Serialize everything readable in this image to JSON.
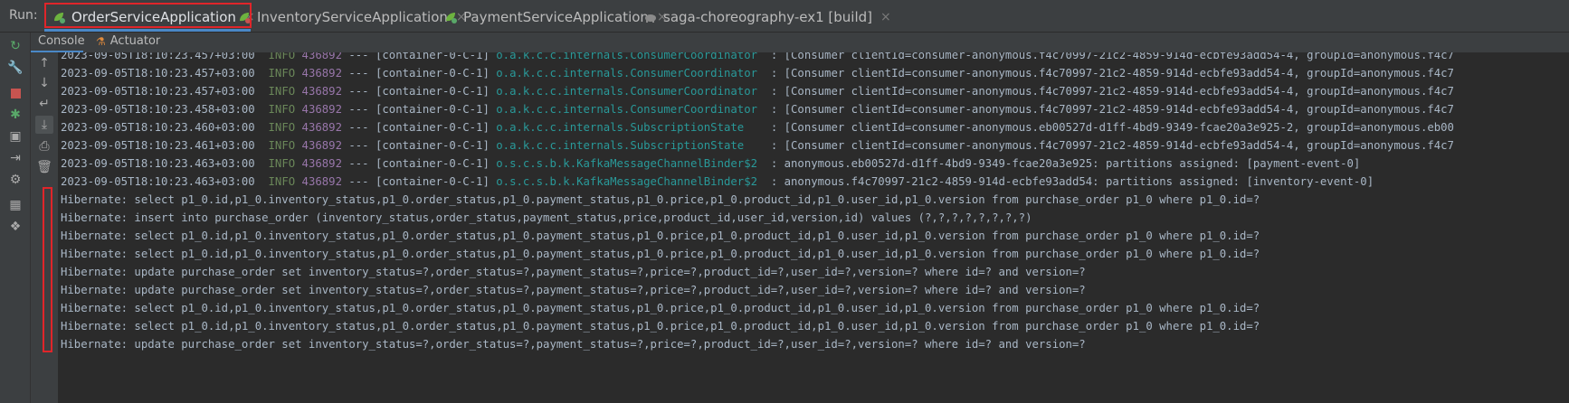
{
  "run_label": "Run:",
  "tabs": [
    {
      "label": "OrderServiceApplication",
      "active": true,
      "close": "×"
    },
    {
      "label": "InventoryServiceApplication",
      "active": false,
      "close": "×"
    },
    {
      "label": "PaymentServiceApplication",
      "active": false,
      "close": "×"
    },
    {
      "label": "saga-choreography-ex1 [build]",
      "active": false,
      "close": "×"
    }
  ],
  "subtabs": {
    "console": "Console",
    "actuator": "Actuator"
  },
  "colors": {
    "accent": "#4a88c7",
    "highlight": "#e0252a",
    "info": "#6a8759",
    "pid": "#9876aa",
    "logger": "#299999"
  },
  "log_lines": [
    {
      "ts": "2023-09-05T18:10:23.457+03:00",
      "level": "INFO",
      "pid": "436892",
      "sep": "---",
      "thread": "[container-0-C-1]",
      "logger": "o.a.k.c.c.internals.ConsumerCoordinator ",
      "msg": ": [Consumer clientId=consumer-anonymous.f4c70997-21c2-4859-914d-ecbfe93add54-4, groupId=anonymous.f4c7"
    },
    {
      "ts": "2023-09-05T18:10:23.457+03:00",
      "level": "INFO",
      "pid": "436892",
      "sep": "---",
      "thread": "[container-0-C-1]",
      "logger": "o.a.k.c.c.internals.ConsumerCoordinator ",
      "msg": ": [Consumer clientId=consumer-anonymous.f4c70997-21c2-4859-914d-ecbfe93add54-4, groupId=anonymous.f4c7"
    },
    {
      "ts": "2023-09-05T18:10:23.457+03:00",
      "level": "INFO",
      "pid": "436892",
      "sep": "---",
      "thread": "[container-0-C-1]",
      "logger": "o.a.k.c.c.internals.ConsumerCoordinator ",
      "msg": ": [Consumer clientId=consumer-anonymous.f4c70997-21c2-4859-914d-ecbfe93add54-4, groupId=anonymous.f4c7"
    },
    {
      "ts": "2023-09-05T18:10:23.458+03:00",
      "level": "INFO",
      "pid": "436892",
      "sep": "---",
      "thread": "[container-0-C-1]",
      "logger": "o.a.k.c.c.internals.ConsumerCoordinator ",
      "msg": ": [Consumer clientId=consumer-anonymous.f4c70997-21c2-4859-914d-ecbfe93add54-4, groupId=anonymous.f4c7"
    },
    {
      "ts": "2023-09-05T18:10:23.460+03:00",
      "level": "INFO",
      "pid": "436892",
      "sep": "---",
      "thread": "[container-0-C-1]",
      "logger": "o.a.k.c.c.internals.SubscriptionState   ",
      "msg": ": [Consumer clientId=consumer-anonymous.eb00527d-d1ff-4bd9-9349-fcae20a3e925-2, groupId=anonymous.eb00"
    },
    {
      "ts": "2023-09-05T18:10:23.461+03:00",
      "level": "INFO",
      "pid": "436892",
      "sep": "---",
      "thread": "[container-0-C-1]",
      "logger": "o.a.k.c.c.internals.SubscriptionState   ",
      "msg": ": [Consumer clientId=consumer-anonymous.f4c70997-21c2-4859-914d-ecbfe93add54-4, groupId=anonymous.f4c7"
    },
    {
      "ts": "2023-09-05T18:10:23.463+03:00",
      "level": "INFO",
      "pid": "436892",
      "sep": "---",
      "thread": "[container-0-C-1]",
      "logger": "o.s.c.s.b.k.KafkaMessageChannelBinder$2 ",
      "msg": ": anonymous.eb00527d-d1ff-4bd9-9349-fcae20a3e925: partitions assigned: [payment-event-0]"
    },
    {
      "ts": "2023-09-05T18:10:23.463+03:00",
      "level": "INFO",
      "pid": "436892",
      "sep": "---",
      "thread": "[container-0-C-1]",
      "logger": "o.s.c.s.b.k.KafkaMessageChannelBinder$2 ",
      "msg": ": anonymous.f4c70997-21c2-4859-914d-ecbfe93add54: partitions assigned: [inventory-event-0]"
    }
  ],
  "hibernate_lines": [
    "Hibernate: select p1_0.id,p1_0.inventory_status,p1_0.order_status,p1_0.payment_status,p1_0.price,p1_0.product_id,p1_0.user_id,p1_0.version from purchase_order p1_0 where p1_0.id=?",
    "Hibernate: insert into purchase_order (inventory_status,order_status,payment_status,price,product_id,user_id,version,id) values (?,?,?,?,?,?,?,?)",
    "Hibernate: select p1_0.id,p1_0.inventory_status,p1_0.order_status,p1_0.payment_status,p1_0.price,p1_0.product_id,p1_0.user_id,p1_0.version from purchase_order p1_0 where p1_0.id=?",
    "Hibernate: select p1_0.id,p1_0.inventory_status,p1_0.order_status,p1_0.payment_status,p1_0.price,p1_0.product_id,p1_0.user_id,p1_0.version from purchase_order p1_0 where p1_0.id=?",
    "Hibernate: update purchase_order set inventory_status=?,order_status=?,payment_status=?,price=?,product_id=?,user_id=?,version=? where id=? and version=?",
    "Hibernate: update purchase_order set inventory_status=?,order_status=?,payment_status=?,price=?,product_id=?,user_id=?,version=? where id=? and version=?",
    "Hibernate: select p1_0.id,p1_0.inventory_status,p1_0.order_status,p1_0.payment_status,p1_0.price,p1_0.product_id,p1_0.user_id,p1_0.version from purchase_order p1_0 where p1_0.id=?",
    "Hibernate: select p1_0.id,p1_0.inventory_status,p1_0.order_status,p1_0.payment_status,p1_0.price,p1_0.product_id,p1_0.user_id,p1_0.version from purchase_order p1_0 where p1_0.id=?",
    "Hibernate: update purchase_order set inventory_status=?,order_status=?,payment_status=?,price=?,product_id=?,user_id=?,version=? where id=? and version=?"
  ],
  "tool_icons": [
    "rerun-icon",
    "wrench-icon",
    "stop-icon",
    "debug-bug-icon",
    "camera-icon",
    "exit-icon",
    "settings-search-icon",
    "layout-icon",
    "pin-icon"
  ],
  "action_icons": [
    "arrow-up-icon",
    "arrow-down-icon",
    "soft-wrap-icon",
    "scroll-to-end-icon",
    "print-icon",
    "trash-icon"
  ]
}
